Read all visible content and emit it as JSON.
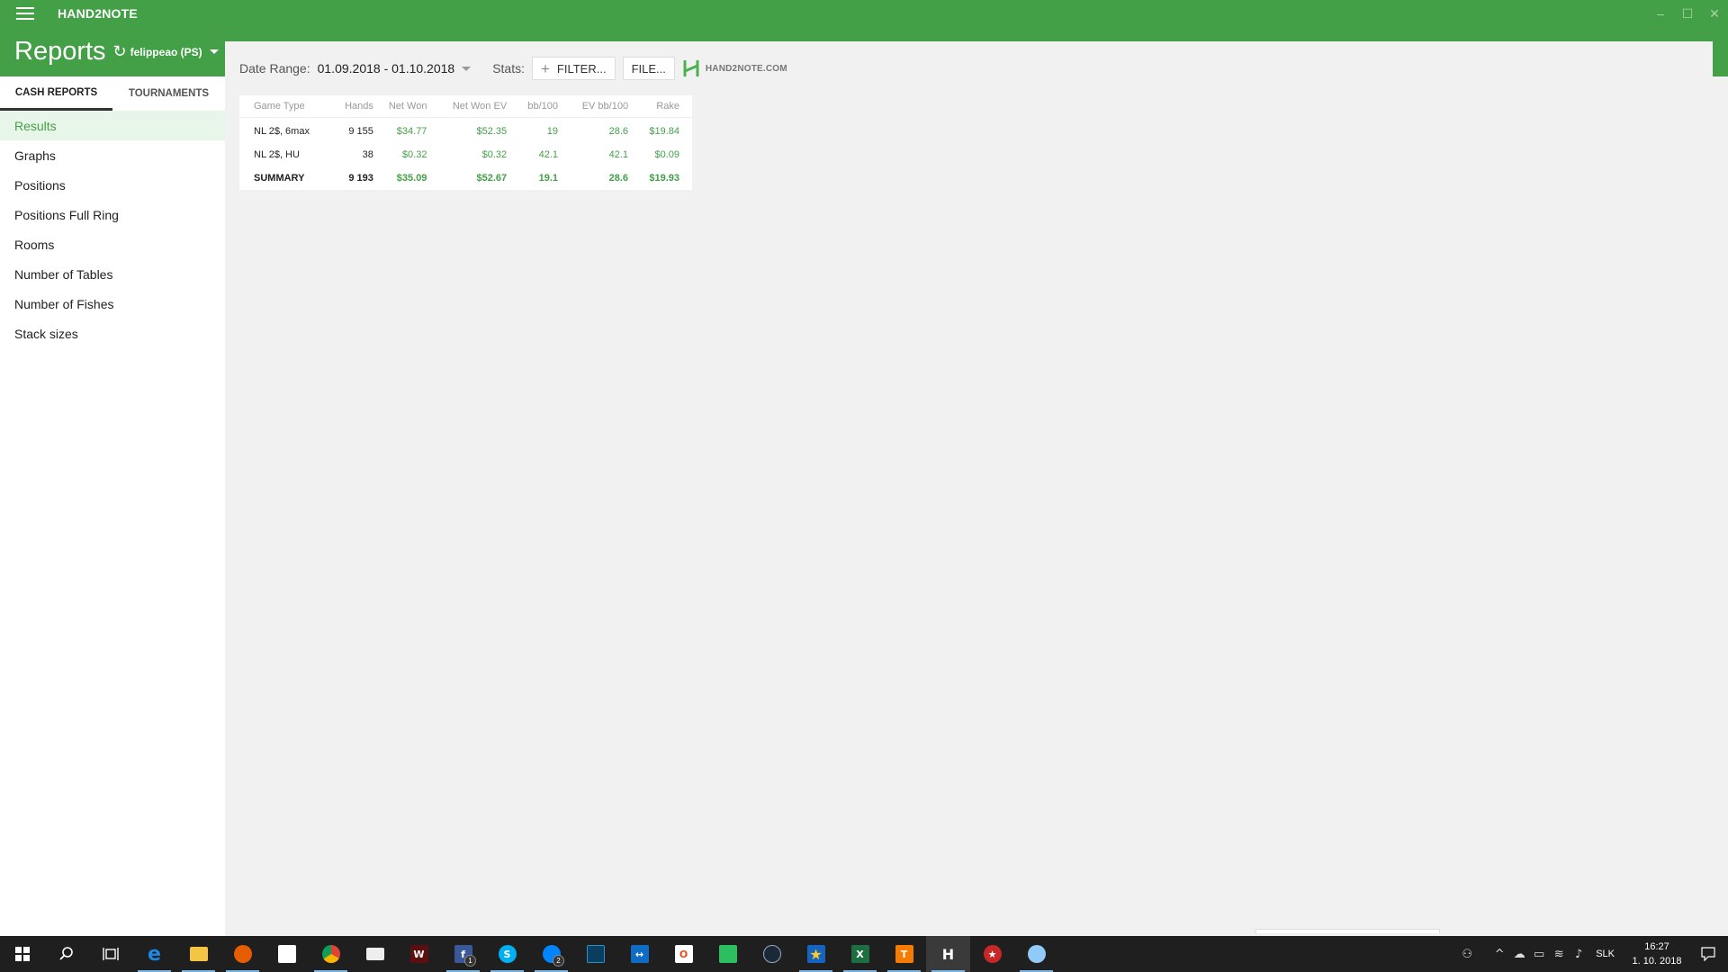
{
  "app": {
    "title": "HAND2NOTE"
  },
  "window_controls": {
    "minimize": "–",
    "maximize": "☐",
    "close": "✕"
  },
  "header": {
    "title": "Reports",
    "player": "felippeao (PS)"
  },
  "sidebar": {
    "tabs": [
      {
        "label": "CASH REPORTS"
      },
      {
        "label": "TOURNAMENTS"
      }
    ],
    "items": [
      {
        "label": "Results"
      },
      {
        "label": "Graphs"
      },
      {
        "label": "Positions"
      },
      {
        "label": "Positions Full Ring"
      },
      {
        "label": "Rooms"
      },
      {
        "label": "Number of Tables"
      },
      {
        "label": "Number of Fishes"
      },
      {
        "label": "Stack sizes"
      }
    ]
  },
  "toolbar": {
    "date_range_label": "Date Range:",
    "date_range_value": "01.09.2018 - 01.10.2018",
    "stats_label": "Stats:",
    "filter_label": "FILTER...",
    "file_label": "FILE...",
    "logo_text": "HAND2NOTE.COM"
  },
  "results_table": {
    "columns": [
      "Game Type",
      "Hands",
      "Net Won",
      "Net Won  EV",
      "bb/100",
      "EV bb/100",
      "Rake"
    ],
    "rows": [
      [
        "NL 2$, 6max",
        "9 155",
        "$34.77",
        "$52.35",
        "19",
        "28.6",
        "$19.84"
      ],
      [
        "NL 2$, HU",
        "38",
        "$0.32",
        "$0.32",
        "42.1",
        "42.1",
        "$0.09"
      ]
    ],
    "summary": [
      "SUMMARY",
      "9 193",
      "$35.09",
      "$52.67",
      "19.1",
      "28.6",
      "$19.93"
    ]
  },
  "colors": {
    "accent": "#43a047",
    "positive": "#43a047",
    "taskbar": "#1f1f1f"
  },
  "taskbar": {
    "icons": [
      "windows-start-icon",
      "search-icon",
      "task-view-icon",
      "edge-icon",
      "file-explorer-icon",
      "firefox-icon",
      "store-icon",
      "chrome-icon",
      "mail-icon",
      "game-icon",
      "facebook-icon",
      "skype-icon",
      "messenger-icon",
      "app-icon",
      "teamviewer-icon",
      "office-icon",
      "evernote-icon",
      "steam-icon",
      "star-app-icon",
      "excel-icon",
      "orange-app-icon",
      "hand2note-icon",
      "pokerstars-icon",
      "paint-icon"
    ],
    "facebook_badge": "1",
    "messenger_badge": "2",
    "language": "SLK",
    "time": "16:27",
    "date": "1. 10. 2018"
  }
}
